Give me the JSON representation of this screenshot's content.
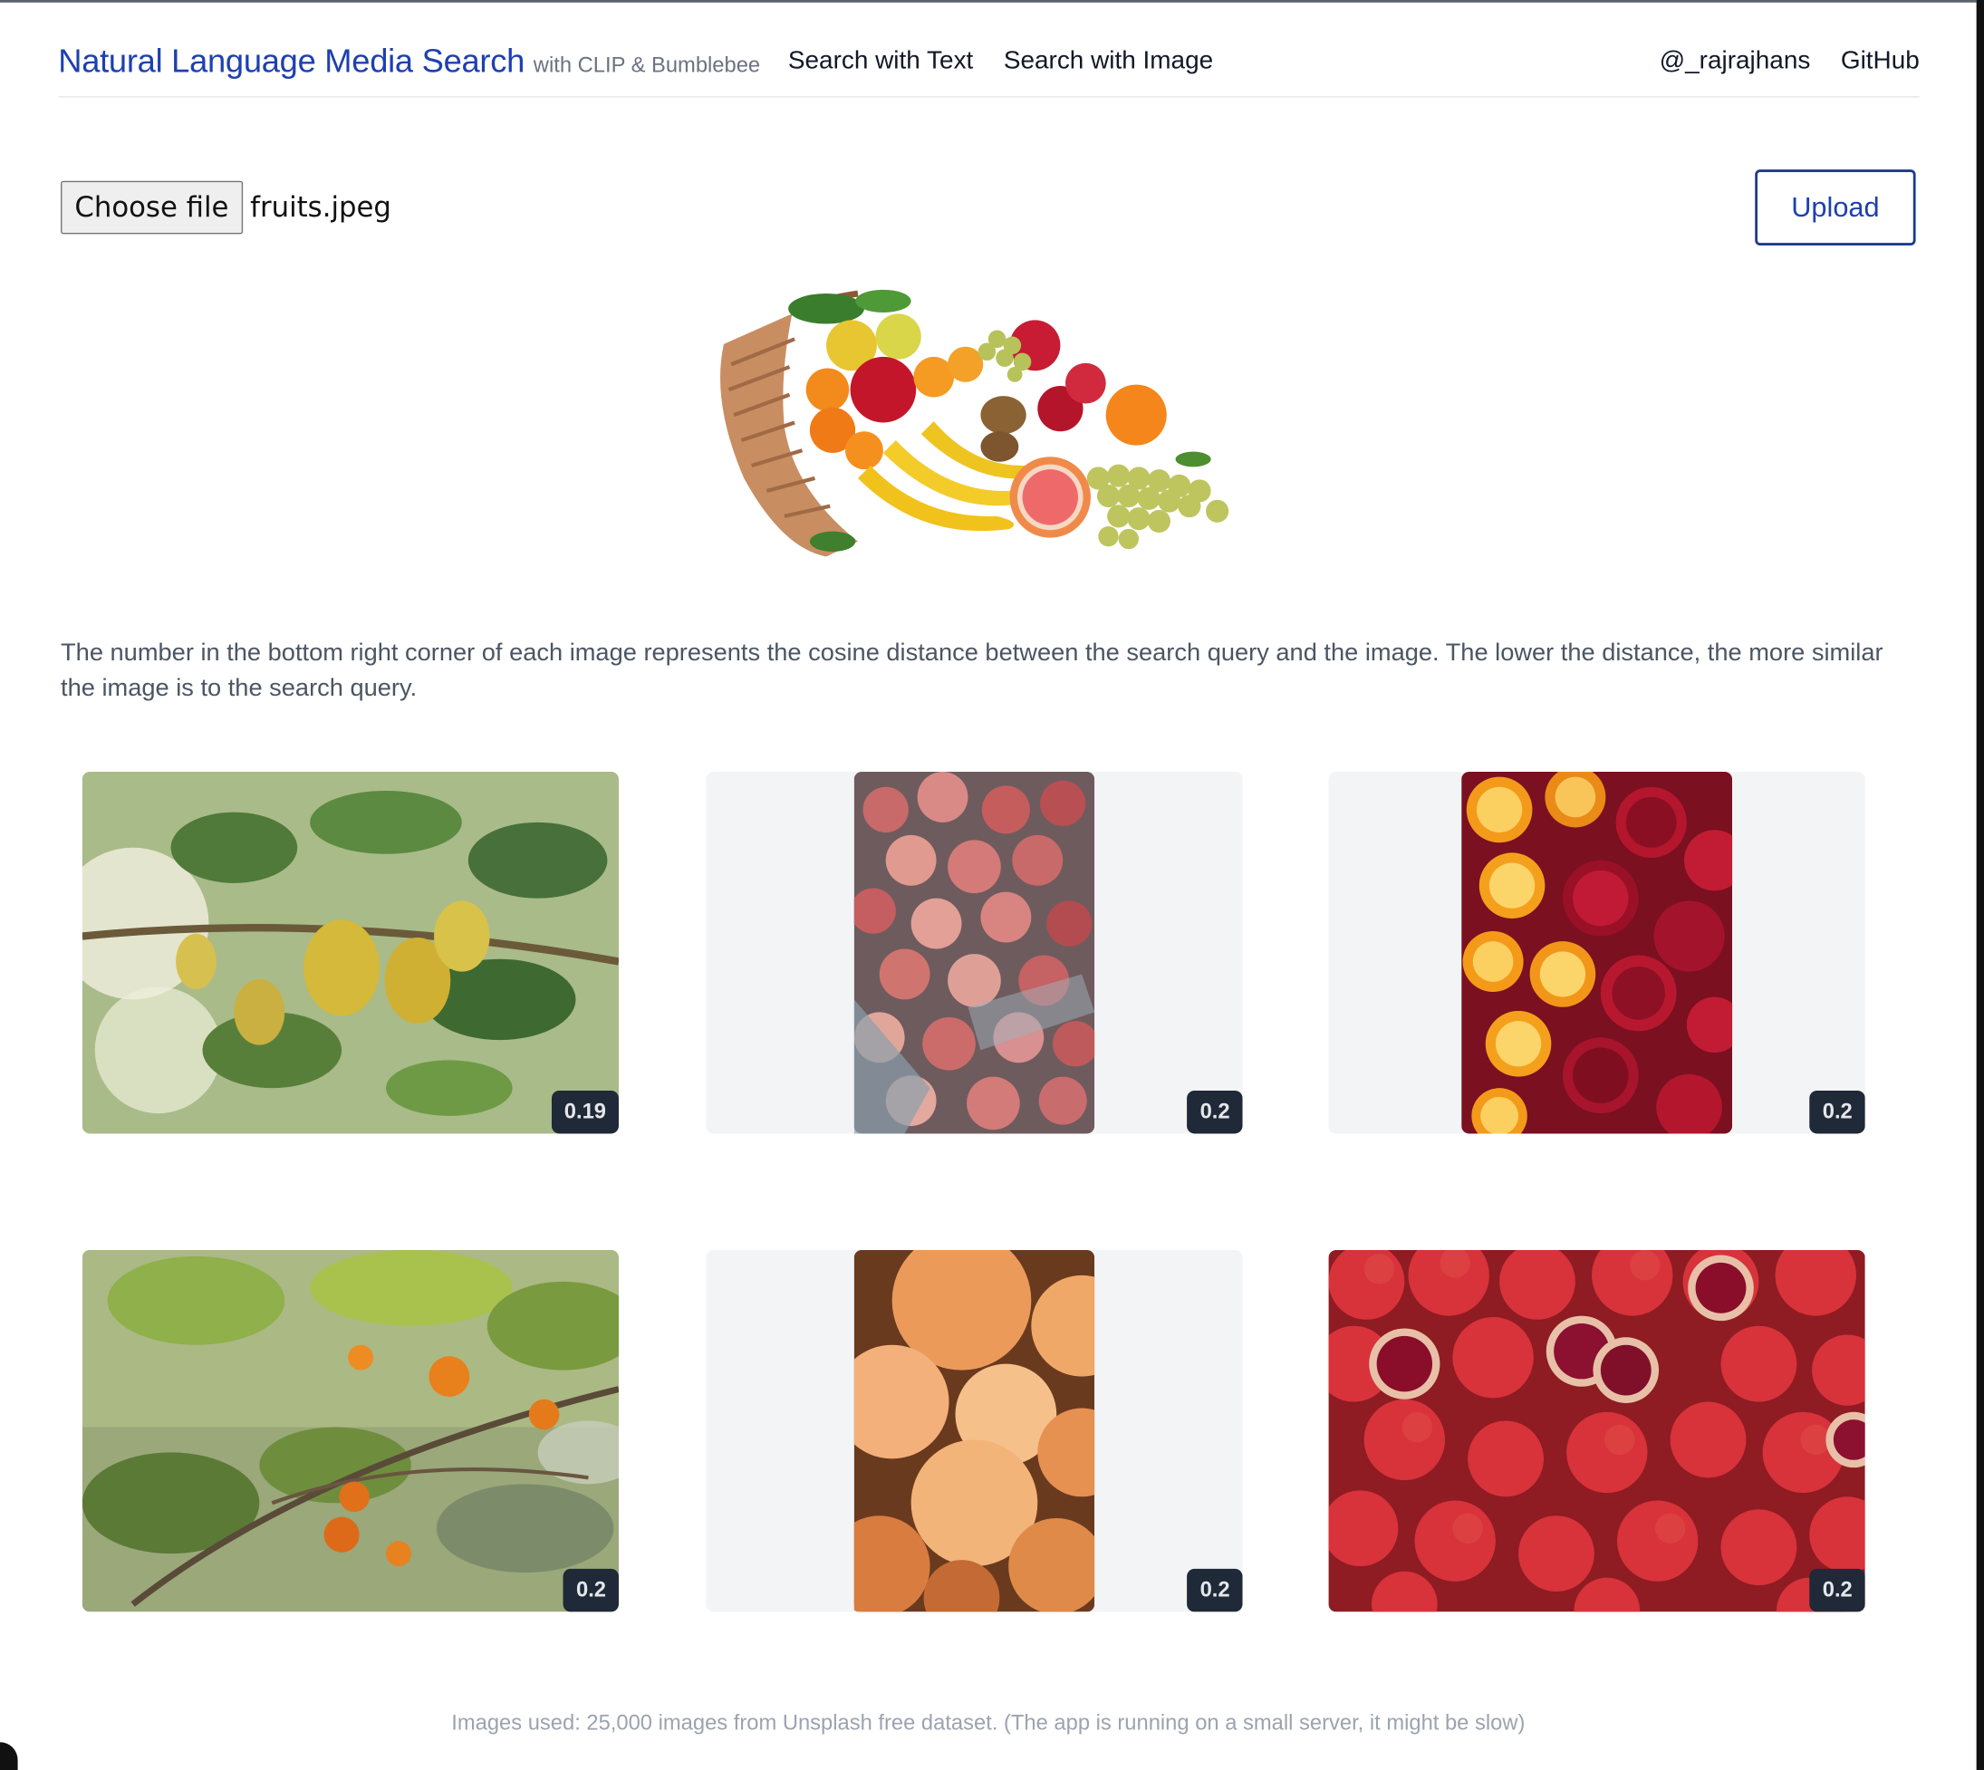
{
  "header": {
    "title": "Natural Language Media Search",
    "subtitle": "with CLIP & Bumblebee",
    "nav": [
      "Search with Text",
      "Search with Image"
    ],
    "handle": "@_rajrajhans",
    "github": "GitHub"
  },
  "upload": {
    "choose_label": "Choose file",
    "file_name": "fruits.jpeg",
    "upload_label": "Upload"
  },
  "query_image": {
    "alt": "fruits basket"
  },
  "explanation": "The number in the bottom right corner of each image represents the cosine distance between the search query and the image. The lower the distance, the more similar the image is to the search query.",
  "results": [
    {
      "subject": "quince-tree-photo",
      "score": "0.19"
    },
    {
      "subject": "peaches-basket-photo",
      "score": "0.2"
    },
    {
      "subject": "oranges-pomegranates-photo",
      "score": "0.2"
    },
    {
      "subject": "orange-tree-photo",
      "score": "0.2"
    },
    {
      "subject": "apricots-photo",
      "score": "0.2"
    },
    {
      "subject": "pomegranates-pile-photo",
      "score": "0.2"
    }
  ],
  "footer": "Images used: 25,000 images from Unsplash free dataset. (The app is running on a small server, it might be slow)",
  "colors": {
    "brand": "#1e40af",
    "score_badge": "#1f2937",
    "card_bg": "#f3f4f6"
  }
}
